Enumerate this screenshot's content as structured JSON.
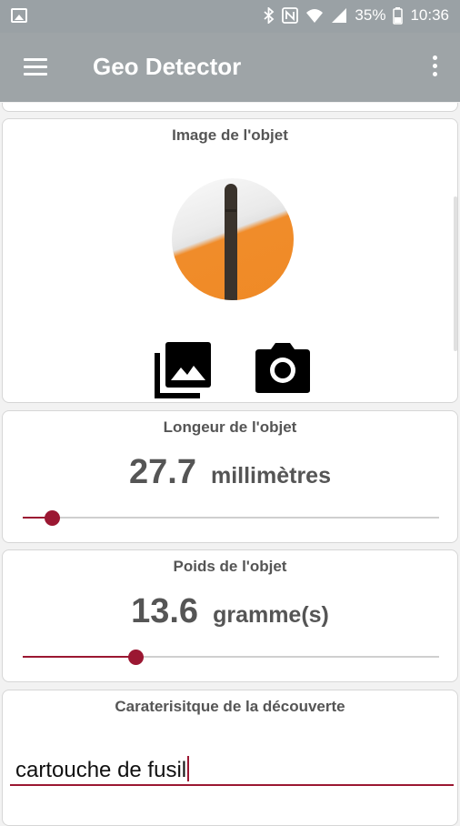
{
  "status_bar": {
    "battery": "35%",
    "time": "10:36",
    "icons": [
      "gallery-notification-icon",
      "bluetooth-icon",
      "nfc-icon",
      "wifi-icon",
      "signal-icon",
      "battery-icon"
    ]
  },
  "app_bar": {
    "title": "Geo Detector",
    "menu_icon": "hamburger-menu-icon",
    "overflow_icon": "more-vert-icon"
  },
  "image_card": {
    "title": "Image de l'objet",
    "gallery_icon": "photo-library-icon",
    "camera_icon": "camera-icon"
  },
  "length_card": {
    "title": "Longeur de l'objet",
    "value": "27.7",
    "unit": "millimètres",
    "slider_fraction": 0.07
  },
  "weight_card": {
    "title": "Poids de l'objet",
    "value": "13.6",
    "unit": "gramme(s)",
    "slider_fraction": 0.27
  },
  "discovery_card": {
    "title": "Caraterisitque de la découverte",
    "input_value": "cartouche de fusil"
  },
  "colors": {
    "accent": "#9b1732",
    "app_bar": "#9ea4a7",
    "status_bar": "#9aa1a5"
  }
}
